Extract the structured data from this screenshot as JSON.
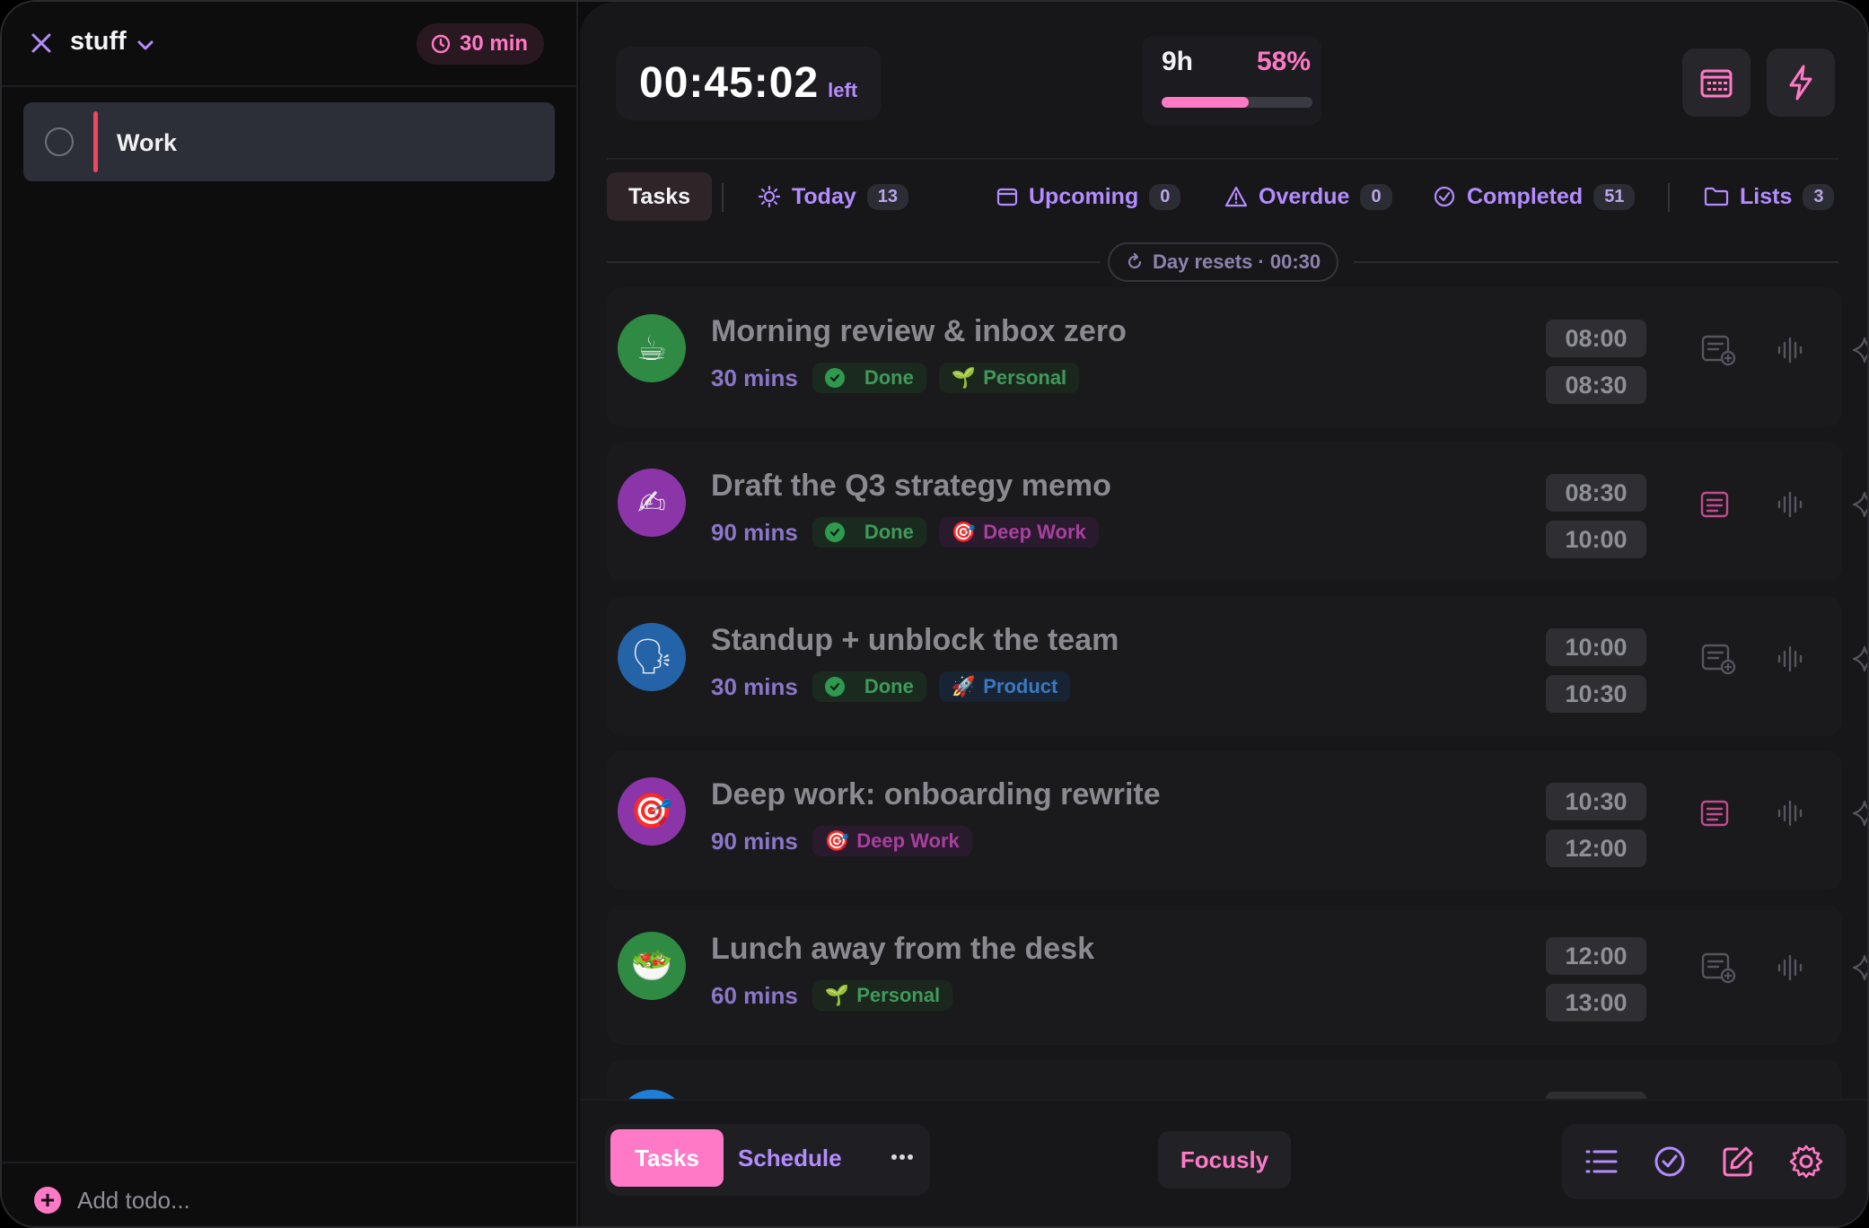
{
  "sidebar": {
    "title": "stuff",
    "timer_label": "30 min",
    "items": [
      {
        "label": "Work",
        "accent": "#f0475e"
      }
    ],
    "add_label": "Add todo..."
  },
  "header": {
    "countdown": "00:45:02",
    "countdown_suffix": "left",
    "hours": "9h",
    "percent": "58%",
    "progress_fraction": 0.58
  },
  "tabs": [
    {
      "label": "Tasks",
      "count": ""
    },
    {
      "label": "Today",
      "count": "13"
    },
    {
      "label": "Upcoming",
      "count": "0"
    },
    {
      "label": "Overdue",
      "count": "0"
    },
    {
      "label": "Completed",
      "count": "51"
    },
    {
      "label": "Lists",
      "count": "3"
    }
  ],
  "day_reset": "Day resets · 00:30",
  "tasks": [
    {
      "title": "Morning review & inbox zero",
      "duration": "30 mins",
      "status": "Done",
      "tag": "Personal",
      "start": "08:00",
      "end": "08:30",
      "emoji": "☕"
    },
    {
      "title": "Draft the Q3 strategy memo",
      "duration": "90 mins",
      "status": "Done",
      "tag": "Deep Work",
      "start": "08:30",
      "end": "10:00",
      "emoji": "✍"
    },
    {
      "title": "Standup + unblock the team",
      "duration": "30 mins",
      "status": "Done",
      "tag": "Product",
      "start": "10:00",
      "end": "10:30",
      "emoji": "🗣"
    },
    {
      "title": "Deep work: onboarding rewrite",
      "duration": "90 mins",
      "status": "",
      "tag": "Deep Work",
      "start": "10:30",
      "end": "12:00",
      "emoji": "🎯"
    },
    {
      "title": "Lunch away from the desk",
      "duration": "60 mins",
      "status": "",
      "tag": "Personal",
      "start": "12:00",
      "end": "13:00",
      "emoji": "🥗"
    }
  ],
  "bottom": {
    "tasks_label": "Tasks",
    "schedule_label": "Schedule",
    "brand": "Focusly"
  },
  "colors": {
    "accent_pink": "#ff79c6",
    "accent_purple": "#b48cff",
    "done_green": "#2f9a4f"
  }
}
